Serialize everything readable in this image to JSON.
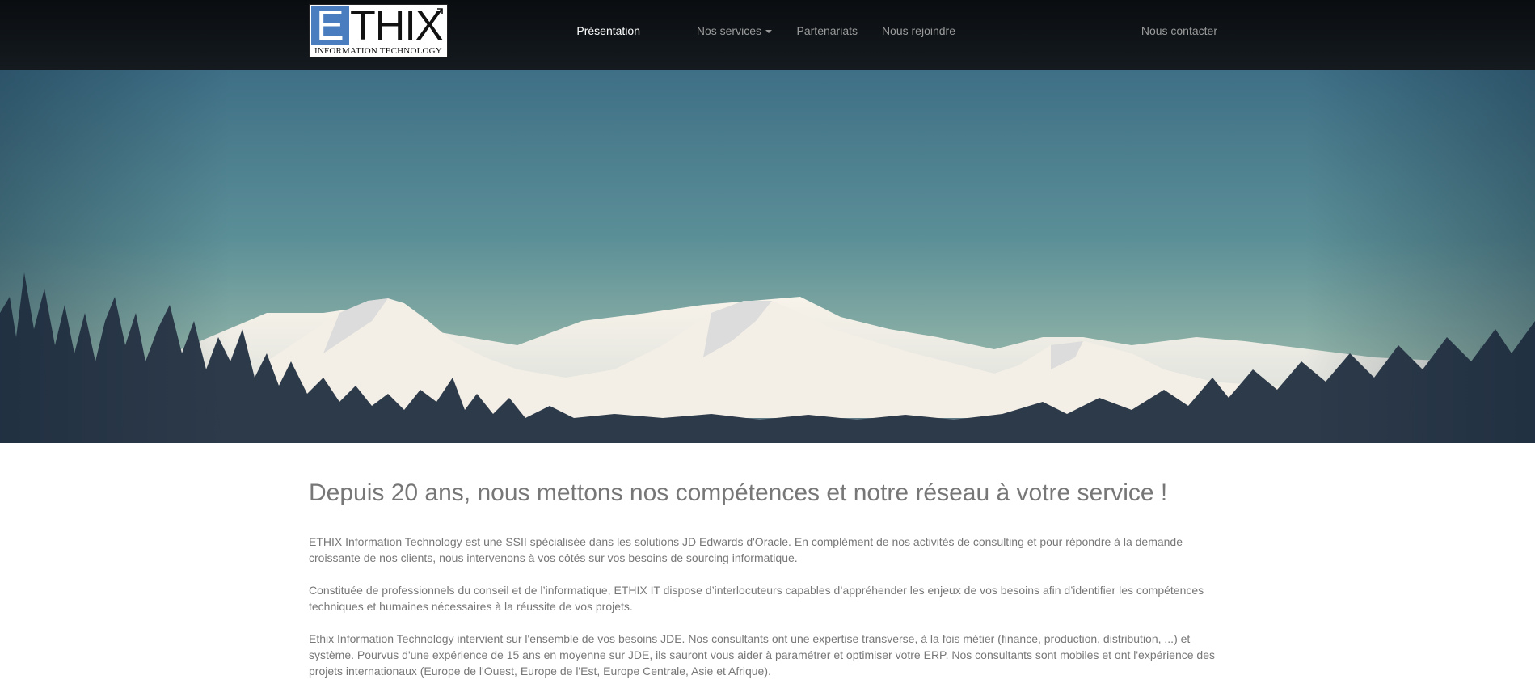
{
  "logo": {
    "name": "ETHIX",
    "tagline": "INFORMATION TECHNOLOGY",
    "brand_blue": "#4a7cc0"
  },
  "nav": {
    "items": [
      {
        "label": "Présentation",
        "active": true
      },
      {
        "label": "Nos services",
        "dropdown": true
      },
      {
        "label": "Partenariats"
      },
      {
        "label": "Nous rejoindre"
      },
      {
        "label": "Nous contacter"
      }
    ]
  },
  "hero": {
    "image": "snowy-mountains-with-pine-trees"
  },
  "main": {
    "headline": "Depuis 20 ans, nous mettons nos compétences et notre réseau à votre service !",
    "paragraphs": [
      "ETHIX Information Technology est une SSII spécialisée dans les solutions JD Edwards d'Oracle. En complément de nos activités de consulting et pour répondre à la demande croissante de nos clients, nous intervenons à vos côtés sur vos besoins de sourcing informatique.",
      "Constituée de professionnels du conseil et de l’informatique, ETHIX IT dispose d’interlocuteurs capables d’appréhender les enjeux de vos besoins afin d’identifier les compétences techniques et humaines nécessaires à la réussite de vos projets.",
      "Ethix Information Technology intervient sur l'ensemble de vos besoins JDE. Nos consultants ont une expertise transverse, à la fois métier (finance, production, distribution, ...) et système. Pourvus d'une expérience de 15 ans en moyenne sur JDE, ils sauront vous aider à paramétrer et optimiser votre ERP. Nos consultants sont mobiles et ont l'expérience des projets internationaux (Europe de l'Ouest, Europe de l'Est, Europe Centrale, Asie et Afrique)."
    ]
  }
}
